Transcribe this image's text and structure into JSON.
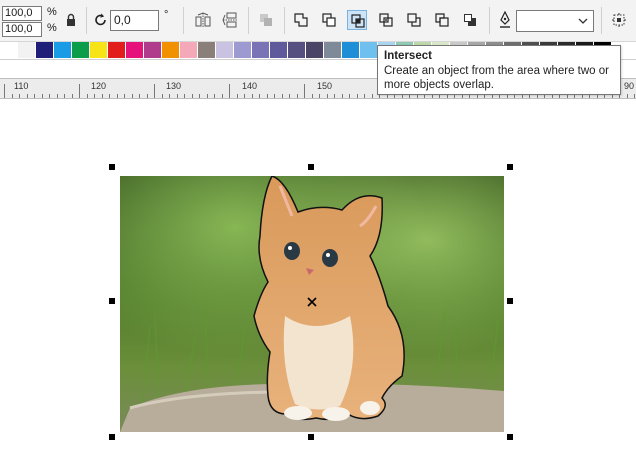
{
  "property_bar": {
    "scale_x": "100,0",
    "scale_y": "100,0",
    "percent_sign": "%",
    "rotation_value": "0,0",
    "degree_sign": "°",
    "outline_width": "",
    "icons": {
      "lock": "lock-ratio-icon",
      "rotate": "rotate-icon",
      "mirror_h": "mirror-horizontal-icon",
      "mirror_v": "mirror-vertical-icon",
      "combine": "combine-icon",
      "weld": "weld-icon",
      "trim": "trim-icon",
      "intersect": "intersect-icon",
      "simplify": "simplify-icon",
      "front_minus_back": "front-minus-back-icon",
      "back_minus_front": "back-minus-front-icon",
      "create_boundary": "create-boundary-icon",
      "outline_pen": "outline-pen-icon",
      "wireframe": "wireframe-icon"
    }
  },
  "palette": {
    "colors": [
      "#ffffff",
      "#f2f2f2",
      "#1f1f7a",
      "#1a9be6",
      "#0b9d4a",
      "#f7e316",
      "#e31d1d",
      "#e5127c",
      "#b03a8c",
      "#f29100",
      "#f4a8b8",
      "#8a8079",
      "#c9c2e0",
      "#9d9ad1",
      "#7a74b6",
      "#5f5a9c",
      "#55507f",
      "#4a4566",
      "#7f8a99",
      "#1e8fd6",
      "#6fc0ee",
      "#a8d6f2",
      "#8ec9b3",
      "#bcd9a7",
      "#d9e8c7",
      "#c8c8c8",
      "#a7a7a7",
      "#8d8d8d",
      "#6e6e6e",
      "#505050",
      "#3a3a3a",
      "#2b2b2b",
      "#1a1a1a",
      "#000000",
      "#ffffff"
    ]
  },
  "ruler": {
    "labels": [
      "110",
      "120",
      "130",
      "140",
      "150",
      "90"
    ]
  },
  "tooltip": {
    "title": "Intersect",
    "body_line1": "Create an object from the area where two or",
    "body_line2": "more objects overlap."
  },
  "colors": {
    "accent": "#cce4f7",
    "toolbar_bg": "#f3f3f3",
    "ruler_bg": "#ececec"
  }
}
